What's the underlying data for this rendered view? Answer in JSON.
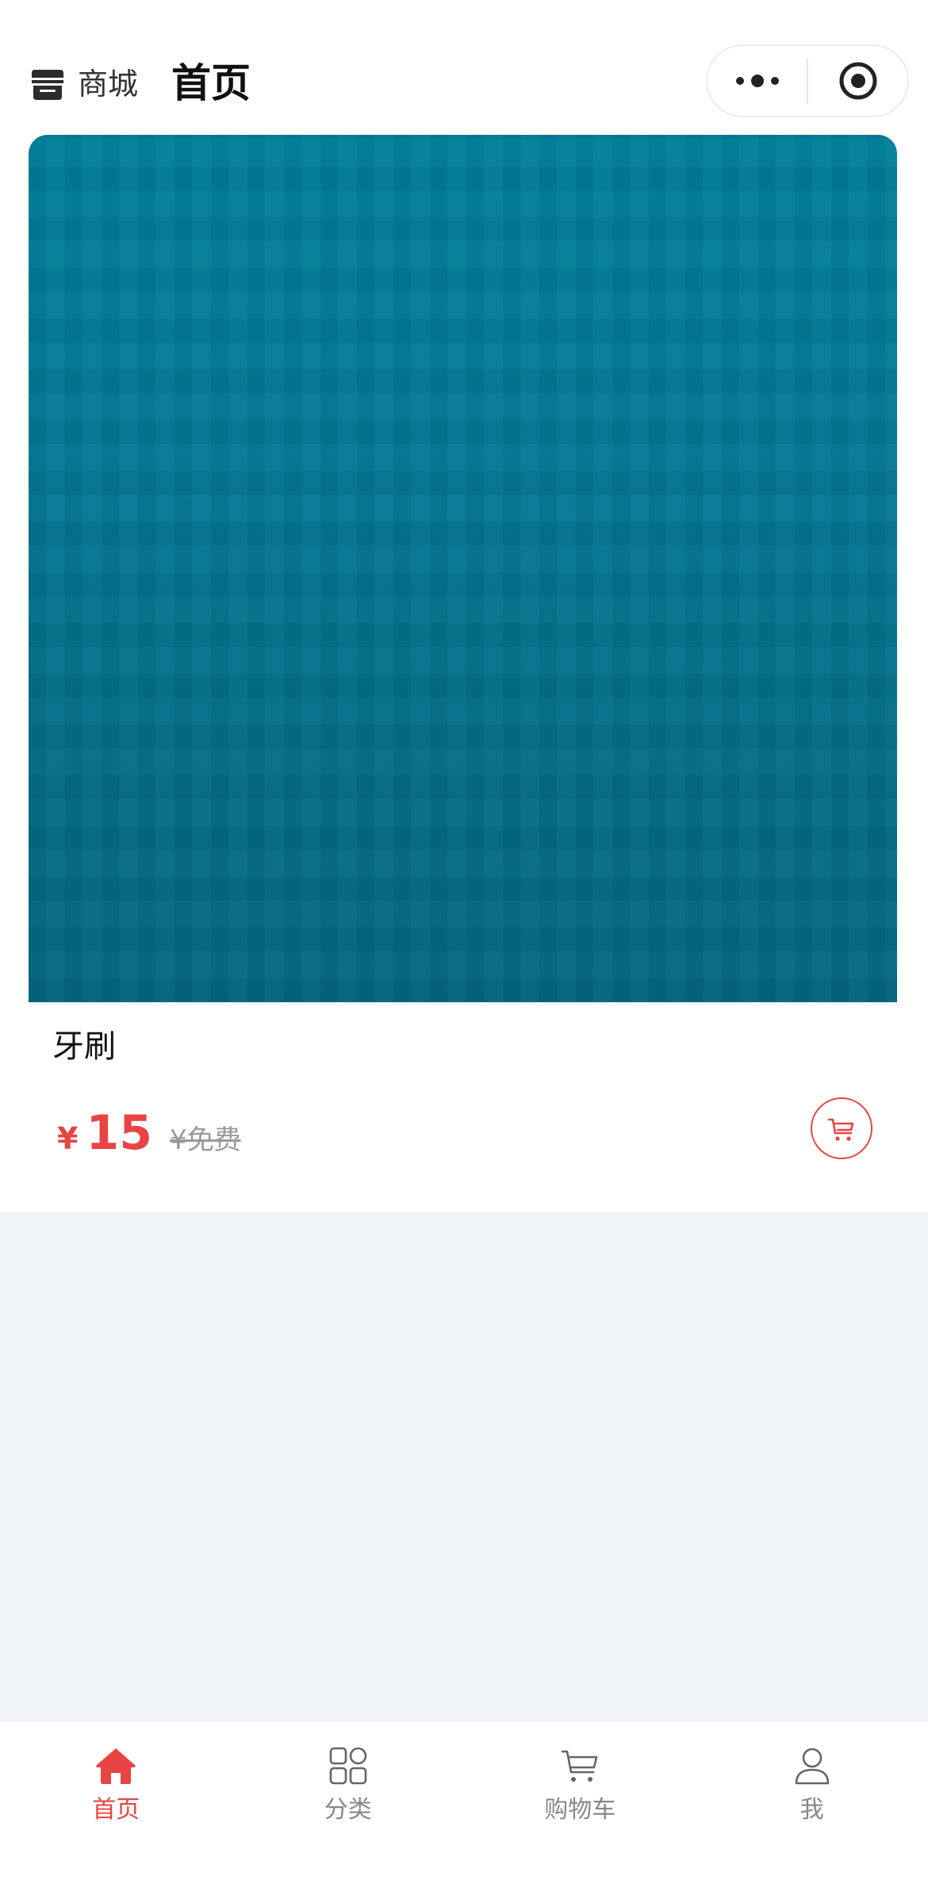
{
  "header": {
    "brand_label": "商城",
    "title": "首页",
    "brand_icon": "store-icon",
    "more_icon": "more-dots-icon",
    "close_icon": "target-circle-icon"
  },
  "product": {
    "name": "牙刷",
    "currency": "¥",
    "price": "15",
    "original_price": "¥免费",
    "cart_icon": "add-to-cart-icon"
  },
  "tabbar": {
    "tabs": [
      {
        "label": "首页",
        "icon": "home-icon",
        "active": true
      },
      {
        "label": "分类",
        "icon": "category-grid-icon",
        "active": false
      },
      {
        "label": "购物车",
        "icon": "cart-icon",
        "active": false
      },
      {
        "label": "我",
        "icon": "user-icon",
        "active": false
      }
    ]
  },
  "colors": {
    "accent": "#e84444",
    "background": "#f2f5f7",
    "image_teal": "#037a94"
  }
}
